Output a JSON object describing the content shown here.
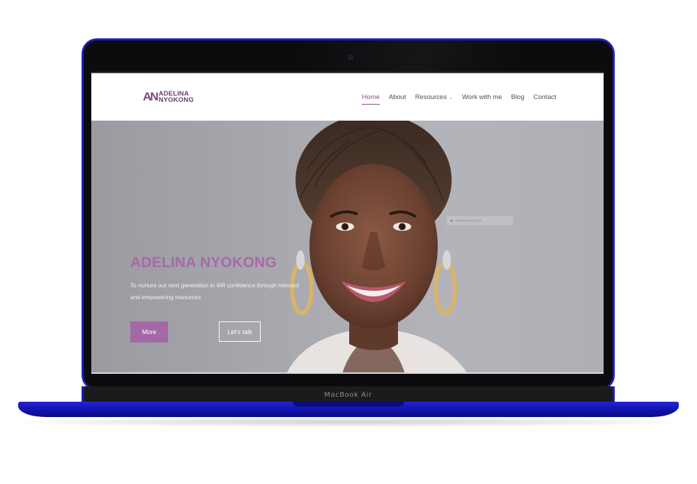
{
  "device": {
    "label": "MacBook Air"
  },
  "site": {
    "logo": {
      "mark": "AN",
      "line1": "ADELINA",
      "line2": "NYOKONG"
    },
    "nav": [
      {
        "label": "Home",
        "active": true
      },
      {
        "label": "About"
      },
      {
        "label": "Resources",
        "has_dropdown": true
      },
      {
        "label": "Work with me"
      },
      {
        "label": "Blog"
      },
      {
        "label": "Contact"
      }
    ],
    "hero": {
      "title": "ADELINA NYOKONG",
      "subtitle": "To nurture our next generation in 4IR confidence through relevant and empowering resources",
      "primary_button": "More",
      "secondary_button": "Let's talk",
      "ghost_text": "Adelina ka Sua"
    }
  },
  "colors": {
    "accent": "#a368a6",
    "laptop_frame": "#1f1fbf",
    "hero_bg": "#a9a9b0"
  }
}
